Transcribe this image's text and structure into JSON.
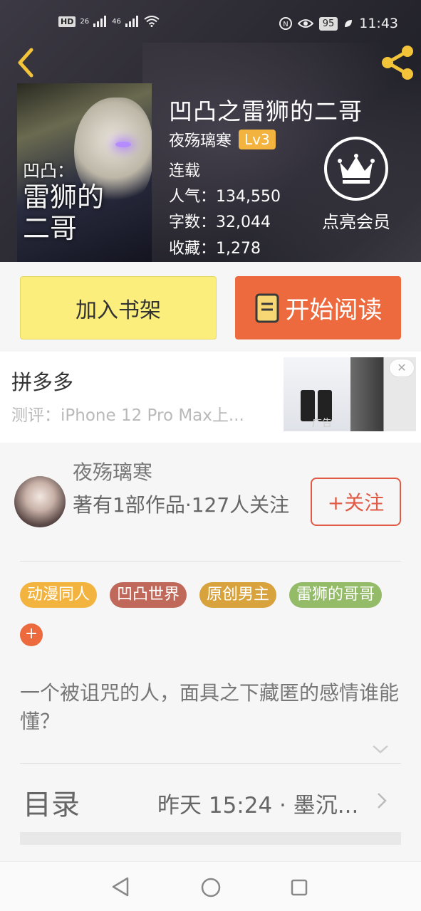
{
  "status_bar": {
    "network_badge": "HD",
    "sim1": "26",
    "sim2": "46",
    "battery": "95",
    "time": "11:43"
  },
  "book": {
    "title": "凹凸之雷狮的二哥",
    "author": "夜殇璃寒",
    "level": "Lv3",
    "status": "连载",
    "popularity": "人气：134,550",
    "word_count": "字数：32,044",
    "favorites": "收藏：1,278",
    "cover_text": [
      "凹凸：",
      "雷狮的",
      "二哥"
    ]
  },
  "vip": {
    "label": "点亮会员"
  },
  "actions": {
    "add_shelf": "加入书架",
    "start_read": "开始阅读"
  },
  "ad": {
    "title": "拼多多",
    "desc": "测评：iPhone 12 Pro Max上...",
    "close": "✕",
    "mark": "广告"
  },
  "author_section": {
    "name": "夜殇璃寒",
    "works": "著有1部作品·127人关注",
    "follow": "+关注"
  },
  "tags": [
    {
      "label": "动漫同人",
      "color": "#f3b43f"
    },
    {
      "label": "凹凸世界",
      "color": "#c0695a"
    },
    {
      "label": "原创男主",
      "color": "#d8a23c"
    },
    {
      "label": "雷狮的哥哥",
      "color": "#93bb68"
    }
  ],
  "tag_add": "+",
  "description": "一个被诅咒的人，面具之下藏匿的感情谁能懂？",
  "toc": {
    "label": "目录",
    "latest": "昨天 15:24 · 墨沉..."
  },
  "colors": {
    "accent_orange": "#ec6a3d",
    "shelf_yellow": "#fbee7c",
    "follow_red": "#e05a45"
  }
}
